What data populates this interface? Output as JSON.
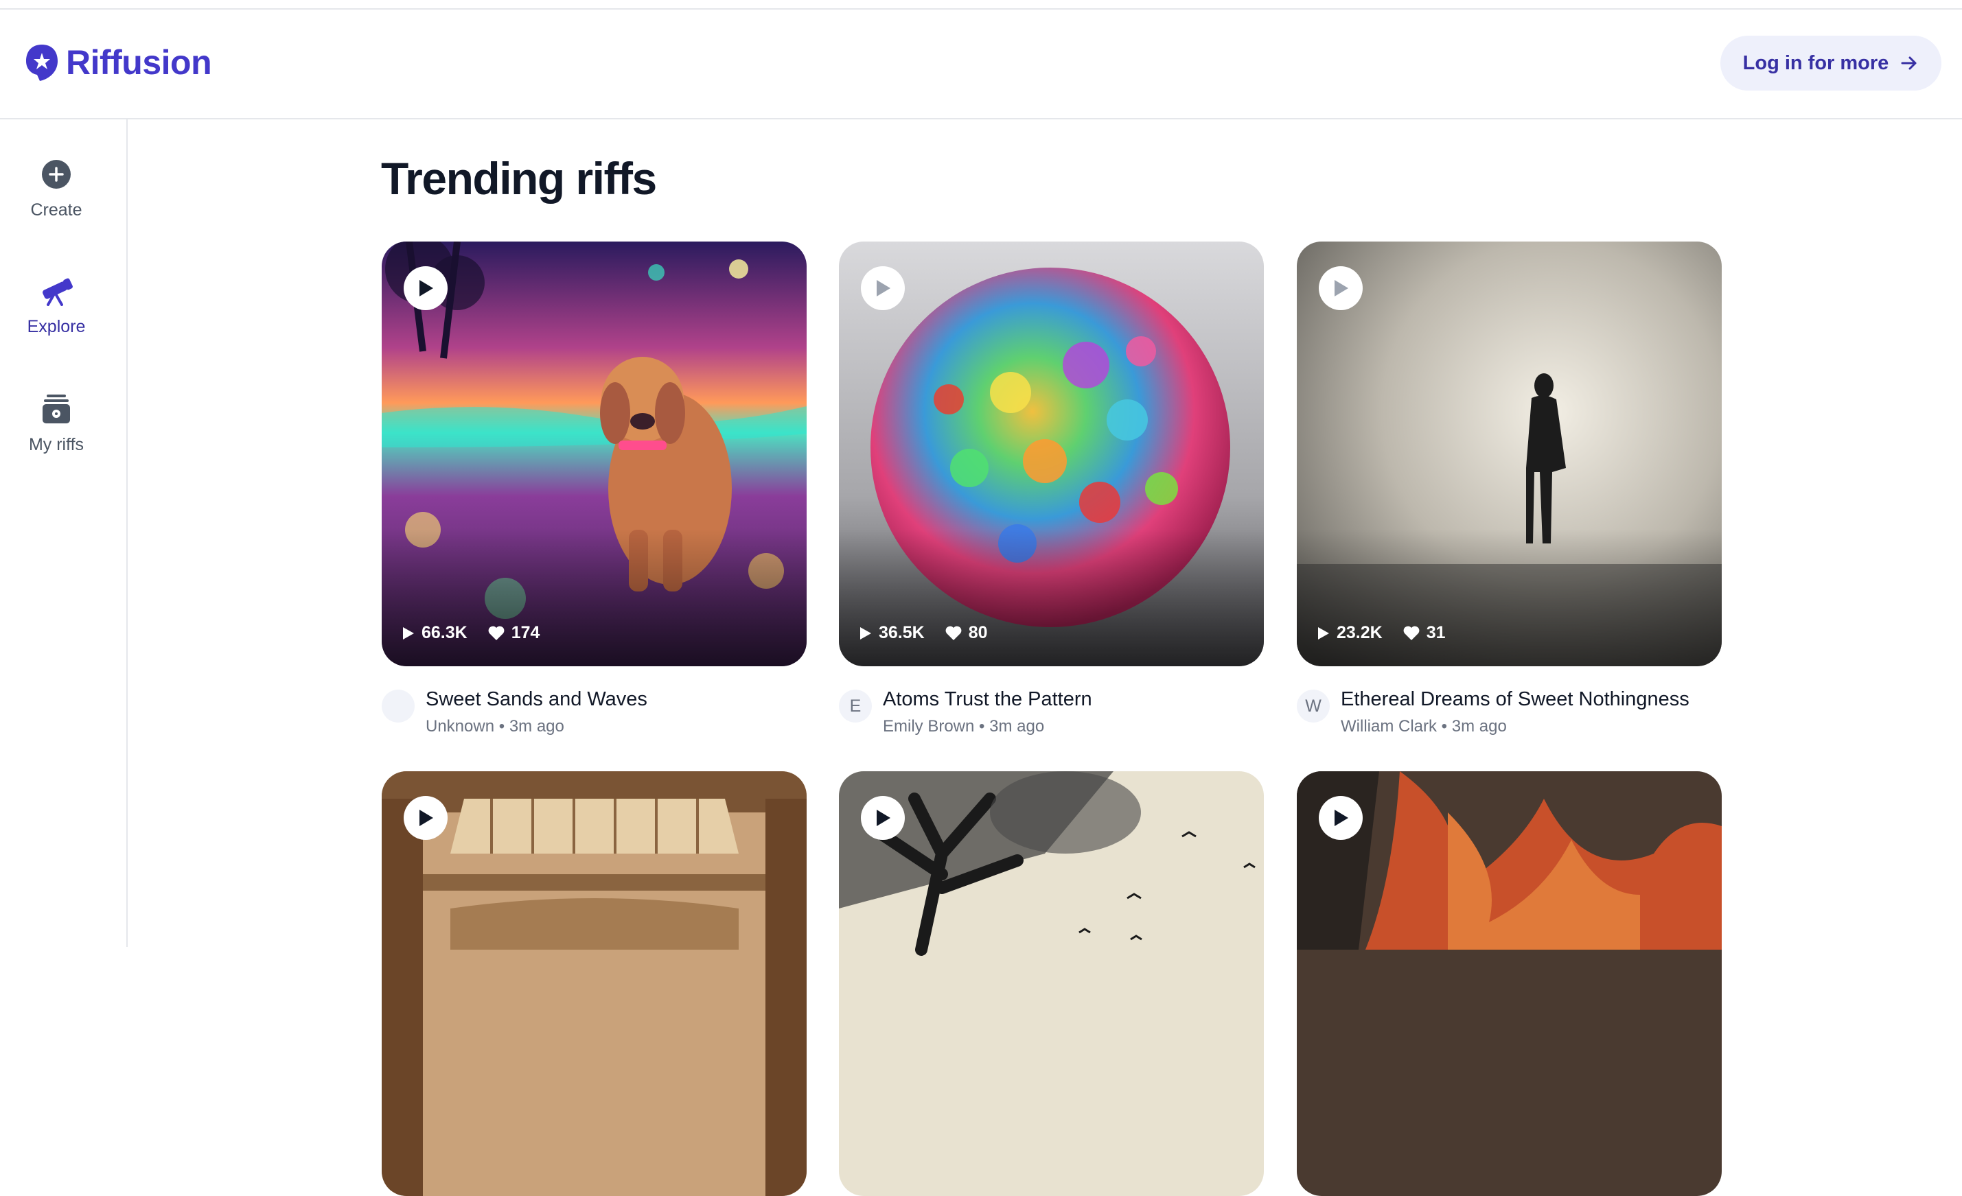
{
  "app": {
    "name": "Riffusion",
    "accent": "#4338ca"
  },
  "header": {
    "login_label": "Log in for more"
  },
  "sidebar": {
    "items": [
      {
        "label": "Create",
        "icon": "plus-circle-icon"
      },
      {
        "label": "Explore",
        "icon": "telescope-icon",
        "active": true
      },
      {
        "label": "My riffs",
        "icon": "library-icon"
      }
    ]
  },
  "main": {
    "heading": "Trending riffs",
    "riffs": [
      {
        "title": "Sweet Sands and Waves",
        "author": "Unknown",
        "time": "3m ago",
        "plays": "66.3K",
        "likes": "174",
        "avatar": "",
        "art": "neon dog on beach"
      },
      {
        "title": "Atoms Trust the Pattern",
        "author": "Emily Brown",
        "time": "3m ago",
        "plays": "36.5K",
        "likes": "80",
        "avatar": "E",
        "art": "mosaic sphere"
      },
      {
        "title": "Ethereal Dreams of Sweet Nothingness",
        "author": "William Clark",
        "time": "3m ago",
        "plays": "23.2K",
        "likes": "31",
        "avatar": "W",
        "art": "figure in fog"
      },
      {
        "art": "sepia hall interior"
      },
      {
        "art": "ink tree with birds"
      },
      {
        "art": "fiery painting"
      }
    ]
  }
}
